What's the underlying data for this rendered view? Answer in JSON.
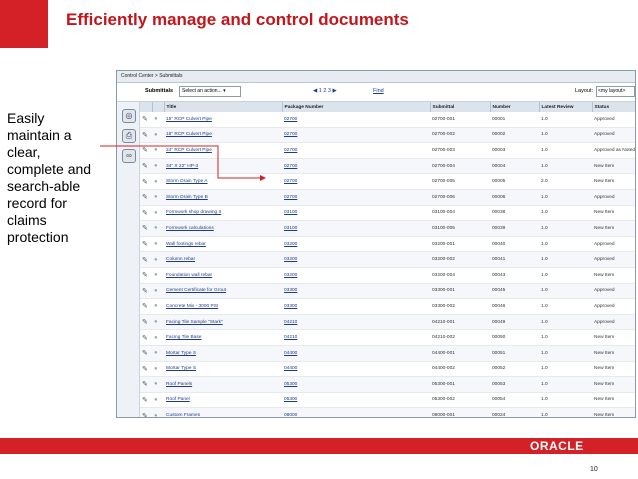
{
  "slide": {
    "title": "Efficiently manage and control documents",
    "callout": "Easily maintain a clear, complete and search-able record for claims protection",
    "brand": "ORACLE",
    "page_number": "10",
    "colors": {
      "accent": "#d42027",
      "title": "#c3161c",
      "link": "#1f3c8a"
    }
  },
  "app": {
    "breadcrumb": "Control Center > Submittals",
    "toolbar": {
      "label": "Submittals",
      "action_select": "Select an action...",
      "pager": "◀ 1 2 3 ▶",
      "find": "Find",
      "layout_label": "Layout:",
      "layout_select": "<my layout>"
    },
    "sidebar_icons": [
      "lifebuoy-icon",
      "printer-icon",
      "binoculars-icon"
    ],
    "columns": [
      "Title",
      "Package Number",
      "Submittal",
      "Number",
      "Latest Review",
      "Status"
    ],
    "rows": [
      {
        "title": "15\" RCP Culvert Pipe",
        "package": "02700",
        "submittal": "02700-001",
        "number": "00001",
        "review": "1.0",
        "status": "Approved"
      },
      {
        "title": "18\" RCP Culvert Pipe",
        "package": "02700",
        "submittal": "02700-002",
        "number": "00002",
        "review": "1.0",
        "status": "Approved"
      },
      {
        "title": "24\" RCP Culvert Pipe",
        "package": "02700",
        "submittal": "02700-003",
        "number": "00003",
        "review": "1.0",
        "status": "Approved as Noted"
      },
      {
        "title": "34\" X 22\" HP-3",
        "package": "02700",
        "submittal": "02700-004",
        "number": "00004",
        "review": "1.0",
        "status": "New Item"
      },
      {
        "title": "Storm Drain Type A",
        "package": "02700",
        "submittal": "02700-005",
        "number": "00005",
        "review": "2.0",
        "status": "New Item"
      },
      {
        "title": "Storm Drain Type B",
        "package": "02700",
        "submittal": "02700-006",
        "number": "00006",
        "review": "1.0",
        "status": "Approved"
      },
      {
        "title": "Formwork shop drawing II",
        "package": "03100",
        "submittal": "03100-004",
        "number": "00038",
        "review": "1.0",
        "status": "New Item"
      },
      {
        "title": "Formwork calculations",
        "package": "03100",
        "submittal": "03100-005",
        "number": "00039",
        "review": "1.0",
        "status": "New Item"
      },
      {
        "title": "Wall footings rebar",
        "package": "03200",
        "submittal": "03200-001",
        "number": "00040",
        "review": "1.0",
        "status": "Approved"
      },
      {
        "title": "Column rebar",
        "package": "03200",
        "submittal": "03200-002",
        "number": "00041",
        "review": "1.0",
        "status": "Approved"
      },
      {
        "title": "Foundation wall rebar",
        "package": "03200",
        "submittal": "03200-004",
        "number": "00043",
        "review": "1.0",
        "status": "New Item"
      },
      {
        "title": "Cement Certificate for Grout",
        "package": "03300",
        "submittal": "03300-001",
        "number": "00045",
        "review": "1.0",
        "status": "Approved"
      },
      {
        "title": "Concrete Mix - 3000 PSI",
        "package": "03300",
        "submittal": "03300-002",
        "number": "00046",
        "review": "1.0",
        "status": "Approved"
      },
      {
        "title": "Facing Tile Sample \"Stark\"",
        "package": "04210",
        "submittal": "04210-001",
        "number": "00049",
        "review": "1.0",
        "status": "Approved"
      },
      {
        "title": "Facing Tile Base",
        "package": "04210",
        "submittal": "04210-002",
        "number": "00050",
        "review": "1.0",
        "status": "New Item"
      },
      {
        "title": "Mortar Type S",
        "package": "04400",
        "submittal": "04400-001",
        "number": "00051",
        "review": "1.0",
        "status": "New Item"
      },
      {
        "title": "Mortar Type S",
        "package": "04400",
        "submittal": "04400-002",
        "number": "00052",
        "review": "1.0",
        "status": "New Item"
      },
      {
        "title": "Roof Panels",
        "package": "05300",
        "submittal": "05300-001",
        "number": "00053",
        "review": "1.0",
        "status": "New Item"
      },
      {
        "title": "Roof Panel",
        "package": "05300",
        "submittal": "05300-002",
        "number": "00054",
        "review": "1.0",
        "status": "New Item"
      },
      {
        "title": "Custom Frames",
        "package": "08000",
        "submittal": "08000-001",
        "number": "00024",
        "review": "1.0",
        "status": "New Item"
      }
    ]
  }
}
